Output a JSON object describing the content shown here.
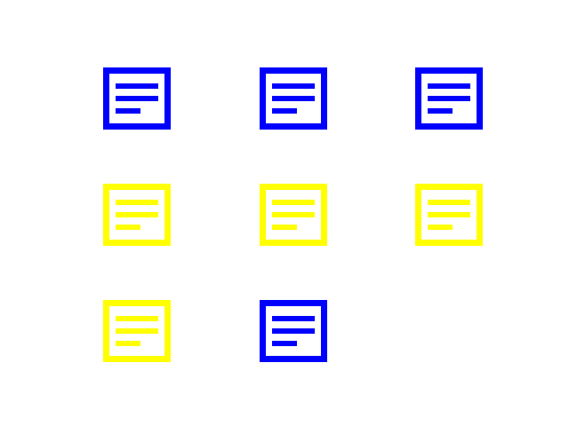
{
  "colors": {
    "blue": "#0000ff",
    "yellow": "#ffff00",
    "background": "#ffffff"
  },
  "icons": [
    {
      "name": "document-icon",
      "color": "blue"
    },
    {
      "name": "document-icon",
      "color": "blue"
    },
    {
      "name": "document-icon",
      "color": "blue"
    },
    {
      "name": "document-icon",
      "color": "yellow"
    },
    {
      "name": "document-icon",
      "color": "yellow"
    },
    {
      "name": "document-icon",
      "color": "yellow"
    },
    {
      "name": "document-icon",
      "color": "yellow"
    },
    {
      "name": "document-icon",
      "color": "blue"
    }
  ]
}
